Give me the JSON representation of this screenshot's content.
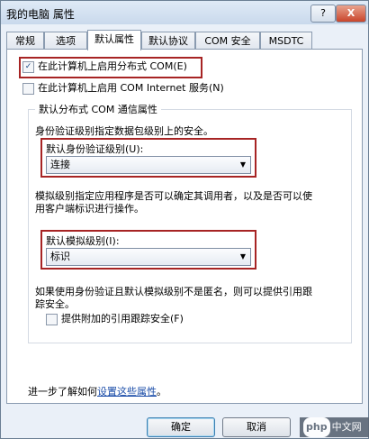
{
  "window": {
    "title": "我的电脑 属性",
    "help_label": "?",
    "close_label": "X"
  },
  "tabs": [
    {
      "label": "常规"
    },
    {
      "label": "选项"
    },
    {
      "label": "默认属性",
      "active": true
    },
    {
      "label": "默认协议"
    },
    {
      "label": "COM 安全"
    },
    {
      "label": "MSDTC"
    }
  ],
  "options": {
    "enable_dcom": {
      "label": "在此计算机上启用分布式 COM(E)",
      "checked": true,
      "check_glyph": "✓"
    },
    "enable_com_internet": {
      "label": "在此计算机上启用 COM Internet 服务(N)",
      "checked": false
    }
  },
  "group": {
    "legend": "默认分布式 COM 通信属性",
    "auth_desc": "身份验证级别指定数据包级别上的安全。",
    "auth_label": "默认身份验证级别(U):",
    "auth_value": "连接",
    "impersonation_desc_1": "模拟级别指定应用程序是否可以确定其调用者，以及是否可以使",
    "impersonation_desc_2": "用客户端标识进行操作。",
    "impersonation_label": "默认模拟级别(I):",
    "impersonation_value": "标识",
    "ref_desc_1": "如果使用身份验证且默认模拟级别不是匿名，则可以提供引用跟",
    "ref_desc_2": "踪安全。",
    "ref_tracking_label": "提供附加的引用跟踪安全(F)"
  },
  "footer": {
    "learn_prefix": "进一步了解如何",
    "learn_link": "设置这些属性",
    "learn_suffix": "。"
  },
  "buttons": {
    "ok": "确定",
    "cancel": "取消"
  },
  "watermark": {
    "logo": "php",
    "text": "中文网"
  },
  "colors": {
    "highlight": "#a72424",
    "link": "#1a4ca8"
  }
}
